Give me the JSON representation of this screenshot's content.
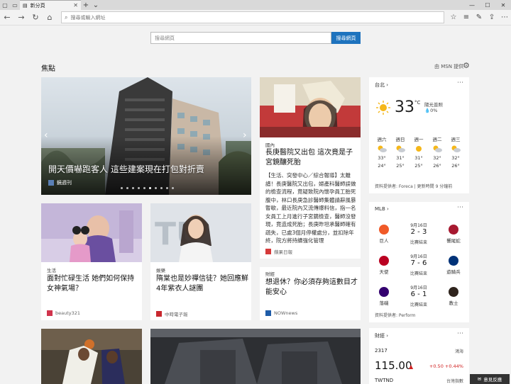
{
  "tab": {
    "title": "新分頁"
  },
  "address": {
    "placeholder": "搜尋或輸入網址"
  },
  "search": {
    "placeholder": "搜尋網頁",
    "button": "搜尋網頁"
  },
  "section": {
    "title": "焦點",
    "provider": "由 MSN 提供"
  },
  "hero": {
    "title": "開天價嚇跑客人 這些建案現在打包對折賣",
    "source": "鏡週刊"
  },
  "card_hospital": {
    "category": "國內",
    "title": "長庚醫院又出包 這次竟是子宮鏡釀死胎",
    "snippet": "【生活、突發中心／綜合報導】太離譜！長庚醫院又出包，婦產科醫師誤做的檢查流程，竟疑致院內懷孕員工胎死腹中，林口長庚急診醫師集體請辭風暴暫歇，最近院內又流傳爆料信，指一名女員工上月進行子宮鏡檢查，醫師沒發現，竟造成死胎；長庚昨坦承醫師確有疏失，已處3個月停權處分，並扣除年終，院方將持續強化管理",
    "source": "蘋果日報"
  },
  "card_parenting": {
    "category": "生活",
    "title": "面對忙碌生活 她們如何保持女神氣場？",
    "source": "beauty321"
  },
  "card_ent": {
    "category": "娛樂",
    "title": "隋棠也是妙禪信徒？她回應鮮4年紫衣人謎團",
    "source": "中時電子報"
  },
  "card_finance": {
    "category": "財經",
    "title": "想退休？你必須存夠這數目才能安心",
    "source": "NOWnews"
  },
  "weather": {
    "city": "台北",
    "temp": "33",
    "unit": "°C",
    "condition": "陽光普照",
    "rain": "0%",
    "days": [
      {
        "day": "週六",
        "hi": "33°",
        "lo": "24°"
      },
      {
        "day": "週日",
        "hi": "31°",
        "lo": "25°"
      },
      {
        "day": "週一",
        "hi": "31°",
        "lo": "25°"
      },
      {
        "day": "週二",
        "hi": "32°",
        "lo": "26°"
      },
      {
        "day": "週三",
        "hi": "32°",
        "lo": "26°"
      }
    ],
    "footer": "資料提供者: Foreca | 更新時間 9 分鐘前"
  },
  "mlb": {
    "title": "MLB",
    "games": [
      {
        "home": "巨人",
        "away": "響尾蛇",
        "date": "9月16日",
        "score": "2 - 3",
        "status": "比賽結束"
      },
      {
        "home": "天使",
        "away": "遊騎兵",
        "date": "9月16日",
        "score": "7 - 6",
        "status": "比賽結束"
      },
      {
        "home": "落磯",
        "away": "教士",
        "date": "9月16日",
        "score": "6 - 1",
        "status": "比賽結束"
      }
    ],
    "footer": "資料提供者: Perform"
  },
  "finance": {
    "title": "財經",
    "sym": "2317",
    "exch": "鴻海",
    "price": "115.00",
    "change": "+0.50 +0.44%",
    "sym2": "TWTND",
    "exch2": "台灣指數"
  },
  "feedback": "意見反應",
  "colors": {
    "accent": "#1e73be",
    "down": "#d02020"
  }
}
